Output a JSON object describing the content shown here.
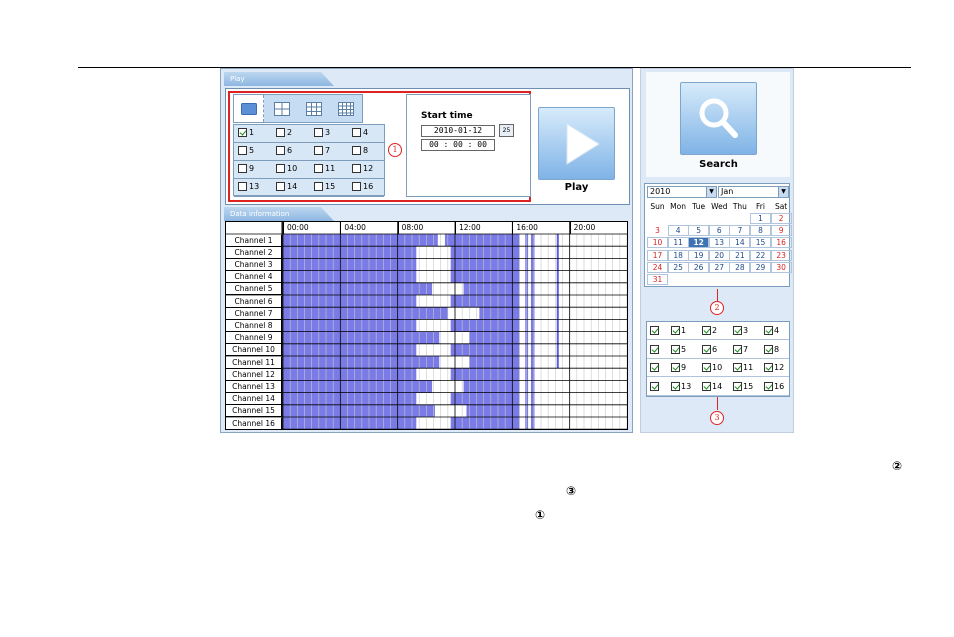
{
  "play_panel": {
    "tab_label": "Play",
    "start_time_label": "Start time",
    "start_date": "2010-01-12",
    "calendar_icon_label": "25",
    "start_time": "00 : 00 : 00",
    "play_label": "Play",
    "layouts": [
      "1x1",
      "2x2",
      "3x3",
      "4x4"
    ],
    "channels": [
      {
        "label": "1",
        "checked": true
      },
      {
        "label": "2",
        "checked": false
      },
      {
        "label": "3",
        "checked": false
      },
      {
        "label": "4",
        "checked": false
      },
      {
        "label": "5",
        "checked": false
      },
      {
        "label": "6",
        "checked": false
      },
      {
        "label": "7",
        "checked": false
      },
      {
        "label": "8",
        "checked": false
      },
      {
        "label": "9",
        "checked": false
      },
      {
        "label": "10",
        "checked": false
      },
      {
        "label": "11",
        "checked": false
      },
      {
        "label": "12",
        "checked": false
      },
      {
        "label": "13",
        "checked": false
      },
      {
        "label": "14",
        "checked": false
      },
      {
        "label": "15",
        "checked": false
      },
      {
        "label": "16",
        "checked": false
      }
    ]
  },
  "data_panel": {
    "tab_label": "Data information",
    "hours": [
      "00:00",
      "04:00",
      "08:00",
      "12:00",
      "16:00",
      "20:00"
    ],
    "channels": [
      {
        "name": "Channel 1",
        "gap_start": 10.8,
        "gap_end": 11.3
      },
      {
        "name": "Channel 2",
        "gap_start": 9.3,
        "gap_end": 11.7
      },
      {
        "name": "Channel 3",
        "gap_start": 9.3,
        "gap_end": 11.7
      },
      {
        "name": "Channel 4",
        "gap_start": 9.3,
        "gap_end": 11.7
      },
      {
        "name": "Channel 5",
        "gap_start": 10.4,
        "gap_end": 12.6
      },
      {
        "name": "Channel 6",
        "gap_start": 9.3,
        "gap_end": 11.7
      },
      {
        "name": "Channel 7",
        "gap_start": 11.5,
        "gap_end": 13.7
      },
      {
        "name": "Channel 8",
        "gap_start": 9.3,
        "gap_end": 11.7
      },
      {
        "name": "Channel 9",
        "gap_start": 10.9,
        "gap_end": 13.0
      },
      {
        "name": "Channel 10",
        "gap_start": 9.3,
        "gap_end": 11.7
      },
      {
        "name": "Channel 11",
        "gap_start": 10.9,
        "gap_end": 13.0
      },
      {
        "name": "Channel 12",
        "gap_start": 9.3,
        "gap_end": 11.7
      },
      {
        "name": "Channel 13",
        "gap_start": 10.4,
        "gap_end": 12.6
      },
      {
        "name": "Channel 14",
        "gap_start": 9.3,
        "gap_end": 11.7
      },
      {
        "name": "Channel 15",
        "gap_start": 10.6,
        "gap_end": 12.8
      },
      {
        "name": "Channel 16",
        "gap_start": 9.3,
        "gap_end": 11.7
      }
    ]
  },
  "search_panel": {
    "search_label": "Search",
    "year": "2010",
    "month": "Jan",
    "weekdays": [
      "Sun",
      "Mon",
      "Tue",
      "Wed",
      "Thu",
      "Fri",
      "Sat"
    ],
    "days": [
      [
        "",
        "",
        "",
        "",
        "",
        "1",
        "2"
      ],
      [
        "3",
        "4",
        "5",
        "6",
        "7",
        "8",
        "9"
      ],
      [
        "10",
        "11",
        "12",
        "13",
        "14",
        "15",
        "16"
      ],
      [
        "17",
        "18",
        "19",
        "20",
        "21",
        "22",
        "23"
      ],
      [
        "24",
        "25",
        "26",
        "27",
        "28",
        "29",
        "30"
      ],
      [
        "31",
        "",
        "",
        "",
        "",
        "",
        ""
      ]
    ],
    "selected_day": "12",
    "recorded_days": [
      "1",
      "2",
      "4",
      "5",
      "6",
      "7",
      "8",
      "9",
      "10",
      "11",
      "12",
      "13",
      "14",
      "15",
      "16",
      "17",
      "18",
      "19",
      "20",
      "21",
      "22",
      "23",
      "24",
      "25",
      "26",
      "27",
      "28",
      "29",
      "30",
      "31"
    ],
    "channel_rows": [
      [
        "",
        "1",
        "2",
        "3",
        "4"
      ],
      [
        "",
        "5",
        "6",
        "7",
        "8"
      ],
      [
        "",
        "9",
        "10",
        "11",
        "12"
      ],
      [
        "",
        "13",
        "14",
        "15",
        "16"
      ]
    ]
  },
  "callouts": {
    "one": "1",
    "two": "2",
    "three": "3",
    "footnote_two": "②",
    "footnote_three": "③",
    "footnote_one": "①"
  },
  "colors": {
    "record": "#7b7be8",
    "event": "#5a5ae0",
    "callout": "#dd2222",
    "accent": "#3e73b4"
  }
}
